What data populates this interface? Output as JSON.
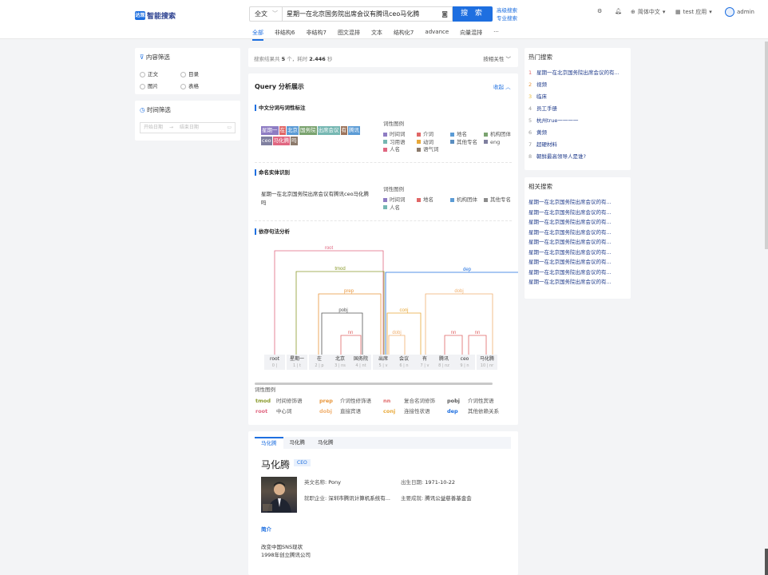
{
  "header": {
    "logo_mark": "达观",
    "logo_text": "智能搜索",
    "scope_select": "全文",
    "query": "星期一在北京国务院出席会议有腾讯ceo马化腾",
    "search_button": "搜 索",
    "advanced_search": "高级搜索",
    "pro_search": "专业搜索",
    "language": "简体中文",
    "app": "test 应用",
    "user": "admin"
  },
  "tabs": [
    "全部",
    "非结构6",
    "非结构7",
    "图文混排",
    "文本",
    "结构化7",
    "advance",
    "向量混排",
    "···"
  ],
  "filters": {
    "content_title": "内容筛选",
    "options": [
      "正文",
      "目录",
      "图片",
      "表格"
    ],
    "time_title": "时间筛选",
    "start_placeholder": "开始日期",
    "end_placeholder": "结束日期"
  },
  "results": {
    "summary_prefix": "搜索结果共",
    "count": "5",
    "summary_mid": "个，耗时",
    "time": "2.446",
    "summary_suffix": "秒",
    "sort": "按相关性"
  },
  "analysis": {
    "title": "Query 分析展示",
    "collapse": "收起",
    "seg_title": "中文分词与词性标注",
    "seg_tokens": [
      {
        "text": "星期一",
        "color": "#8e7cc3"
      },
      {
        "text": "在",
        "color": "#e06666"
      },
      {
        "text": "北京",
        "color": "#5b9bd5"
      },
      {
        "text": "国务院",
        "color": "#7aa36f"
      },
      {
        "text": "出席会议",
        "color": "#76b7b2"
      },
      {
        "text": "有",
        "color": "#9d755d"
      },
      {
        "text": "腾讯",
        "color": "#5b9bd5"
      },
      {
        "text": "ceo",
        "color": "#7f7f9f"
      },
      {
        "text": "马化腾",
        "color": "#e06680"
      },
      {
        "text": "吗",
        "color": "#8c7a6b"
      }
    ],
    "legend_title": "词性图例",
    "seg_legend": [
      {
        "text": "时间词",
        "color": "#8e7cc3"
      },
      {
        "text": "介词",
        "color": "#e06666"
      },
      {
        "text": "地名",
        "color": "#5b9bd5"
      },
      {
        "text": "机构团体",
        "color": "#7aa36f"
      },
      {
        "text": "习用语",
        "color": "#76b7b2"
      },
      {
        "text": "动词",
        "color": "#e8a838"
      },
      {
        "text": "其他专名",
        "color": "#5a8ec0"
      },
      {
        "text": "eng",
        "color": "#7f7f9f"
      },
      {
        "text": "人名",
        "color": "#e06680"
      },
      {
        "text": "语气词",
        "color": "#8c7a6b"
      }
    ],
    "ner_title": "命名实体识别",
    "ner_sentence": "星期一在北京国务院出席会议有腾讯ceo马化腾吗",
    "ner_legend": [
      {
        "text": "时间词",
        "color": "#8e7cc3"
      },
      {
        "text": "地名",
        "color": "#e06666"
      },
      {
        "text": "机构团体",
        "color": "#5b9bd5"
      },
      {
        "text": "其他专名",
        "color": "#8c8c8c"
      },
      {
        "text": "人名",
        "color": "#76b7b2"
      }
    ],
    "dep_title": "依存句法分析",
    "dep_tokens": [
      {
        "w": "root",
        "i": "0 | "
      },
      {
        "w": "星期一",
        "i": "1 | t"
      },
      {
        "w": "在",
        "i": "2 | p"
      },
      {
        "w": "北京",
        "i": "3 | ns"
      },
      {
        "w": "国务院",
        "i": "4 | nt"
      },
      {
        "w": "出席",
        "i": "5 | v"
      },
      {
        "w": "会议",
        "i": "6 | n"
      },
      {
        "w": "有",
        "i": "7 | v"
      },
      {
        "w": "腾讯",
        "i": "8 | nz"
      },
      {
        "w": "ceo",
        "i": "9 | n"
      },
      {
        "w": "马化腾",
        "i": "10 | nr"
      }
    ],
    "dep_arcs": [
      "root",
      "tmod",
      "prep",
      "pobj",
      "nn",
      "dep",
      "conj",
      "dobj",
      "nn",
      "nn",
      "dobj"
    ],
    "dep_legend_title": "词性图例",
    "dep_legend": [
      {
        "tag": "tmod",
        "desc": "时间修饰语",
        "color": "#8a9a2c"
      },
      {
        "tag": "prep",
        "desc": "介词性修饰语",
        "color": "#e8953a"
      },
      {
        "tag": "nn",
        "desc": "复合名词修饰",
        "color": "#e06666"
      },
      {
        "tag": "pobj",
        "desc": "介词性宾语",
        "color": "#555555"
      },
      {
        "tag": "root",
        "desc": "中心词",
        "color": "#e06680"
      },
      {
        "tag": "dobj",
        "desc": "直接宾语",
        "color": "#f0b070"
      },
      {
        "tag": "conj",
        "desc": "连接性状语",
        "color": "#e8a838"
      },
      {
        "tag": "dep",
        "desc": "其他依赖关系",
        "color": "#1e6fe0"
      }
    ]
  },
  "entity": {
    "tabs": [
      "马化腾",
      "马化腾",
      "马化腾"
    ],
    "name": "马化腾",
    "badge": "CEO",
    "en_label": "英文名称:",
    "en_value": "Pony",
    "birth_label": "出生日期:",
    "birth_value": "1971-10-22",
    "company_label": "就职企业:",
    "company_value": "深圳市腾讯计算机系统有...",
    "achieve_label": "主要成就:",
    "achieve_value": "腾讯公益慈善基金会",
    "intro_title": "简介",
    "intro_lines": [
      "改变中国SNS现状",
      "1998年创立腾讯公司"
    ]
  },
  "hot": {
    "title": "热门搜索",
    "items": [
      {
        "n": "1",
        "text": "星期一在北京国务院出席会议的有...",
        "color": "#e06666"
      },
      {
        "n": "2",
        "text": "视频",
        "color": "#e8953a"
      },
      {
        "n": "3",
        "text": "临床",
        "color": "#e8b838"
      },
      {
        "n": "4",
        "text": "员工手册",
        "color": "#999999"
      },
      {
        "n": "5",
        "text": "杭州true一一一一",
        "color": "#999999"
      },
      {
        "n": "6",
        "text": "黄频",
        "color": "#999999"
      },
      {
        "n": "7",
        "text": "超硬材料",
        "color": "#999999"
      },
      {
        "n": "8",
        "text": "朝鲜最高领导人是谁?",
        "color": "#999999"
      }
    ]
  },
  "related": {
    "title": "相关搜索",
    "items": [
      "星期一在北京国务院出席会议的有...",
      "星期一在北京国务院出席会议的有...",
      "星期一在北京国务院出席会议的有...",
      "星期一在北京国务院出席会议的有...",
      "星期一在北京国务院出席会议的有...",
      "星期一在北京国务院出席会议的有...",
      "星期一在北京国务院出席会议的有...",
      "星期一在北京国务院出席会议的有...",
      "星期一在北京国务院出席会议的有..."
    ]
  }
}
